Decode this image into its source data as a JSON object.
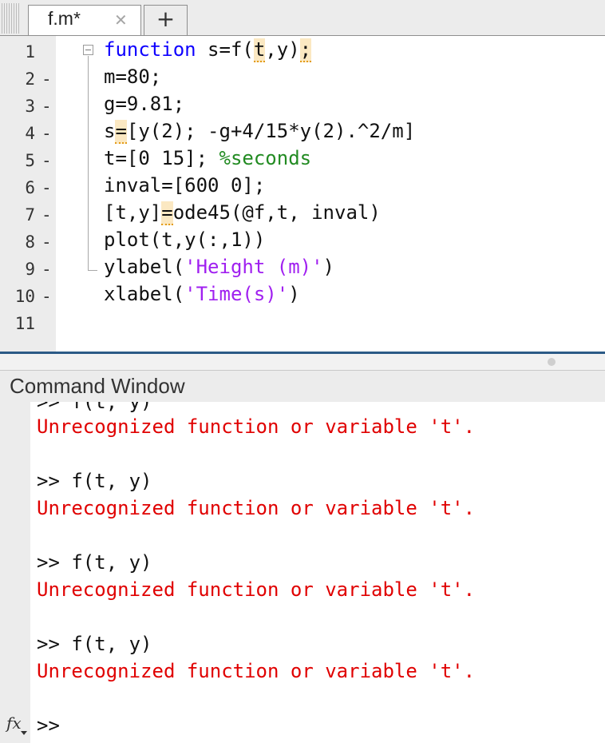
{
  "editor": {
    "tab": {
      "label": "f.m*",
      "close_glyph": "✕",
      "add_glyph": "+"
    },
    "line_numbers": [
      "1",
      "2",
      "3",
      "4",
      "5",
      "6",
      "7",
      "8",
      "9",
      "10",
      "11"
    ],
    "breakpoint_markers": [
      "",
      "-",
      "-",
      "-",
      "-",
      "-",
      "-",
      "-",
      "-",
      "-",
      ""
    ],
    "lines": {
      "l1_kw": "function",
      "l1_a": " s=f(",
      "l1_t": "t",
      "l1_b": ",y)",
      "l1_semi": ";",
      "l2": "m=80;",
      "l3": "g=9.81;",
      "l4_a": "s",
      "l4_eq": "=",
      "l4_b": "[y(2); -g+4/15*y(2).^2/m]",
      "l5_a": "t=[0 15]; ",
      "l5_comment": "%seconds",
      "l6": "inval=[600 0];",
      "l7_a": "[t,y]",
      "l7_eq": "=",
      "l7_b": "ode45(@f,t, inval)",
      "l8": "plot(t,y(:,1))",
      "l9_a": "ylabel(",
      "l9_str": "'Height (m)'",
      "l9_b": ")",
      "l10_a": "xlabel(",
      "l10_str": "'Time(s)'",
      "l10_b": ")"
    }
  },
  "command_window": {
    "title": "Command Window",
    "partial_top": ">> f(t, y)",
    "entries": [
      {
        "error": "Unrecognized function or variable 't'."
      },
      {
        "command": ">> f(t, y)",
        "error": "Unrecognized function or variable 't'."
      },
      {
        "command": ">> f(t, y)",
        "error": "Unrecognized function or variable 't'."
      },
      {
        "command": ">> f(t, y)",
        "error": "Unrecognized function or variable 't'."
      }
    ],
    "prompt": ">>",
    "fx_label": "fx"
  },
  "colors": {
    "keyword": "#0e00ff",
    "comment": "#228b22",
    "string": "#a020f0",
    "error": "#e00000",
    "warning_highlight": "#fbe8c2"
  }
}
